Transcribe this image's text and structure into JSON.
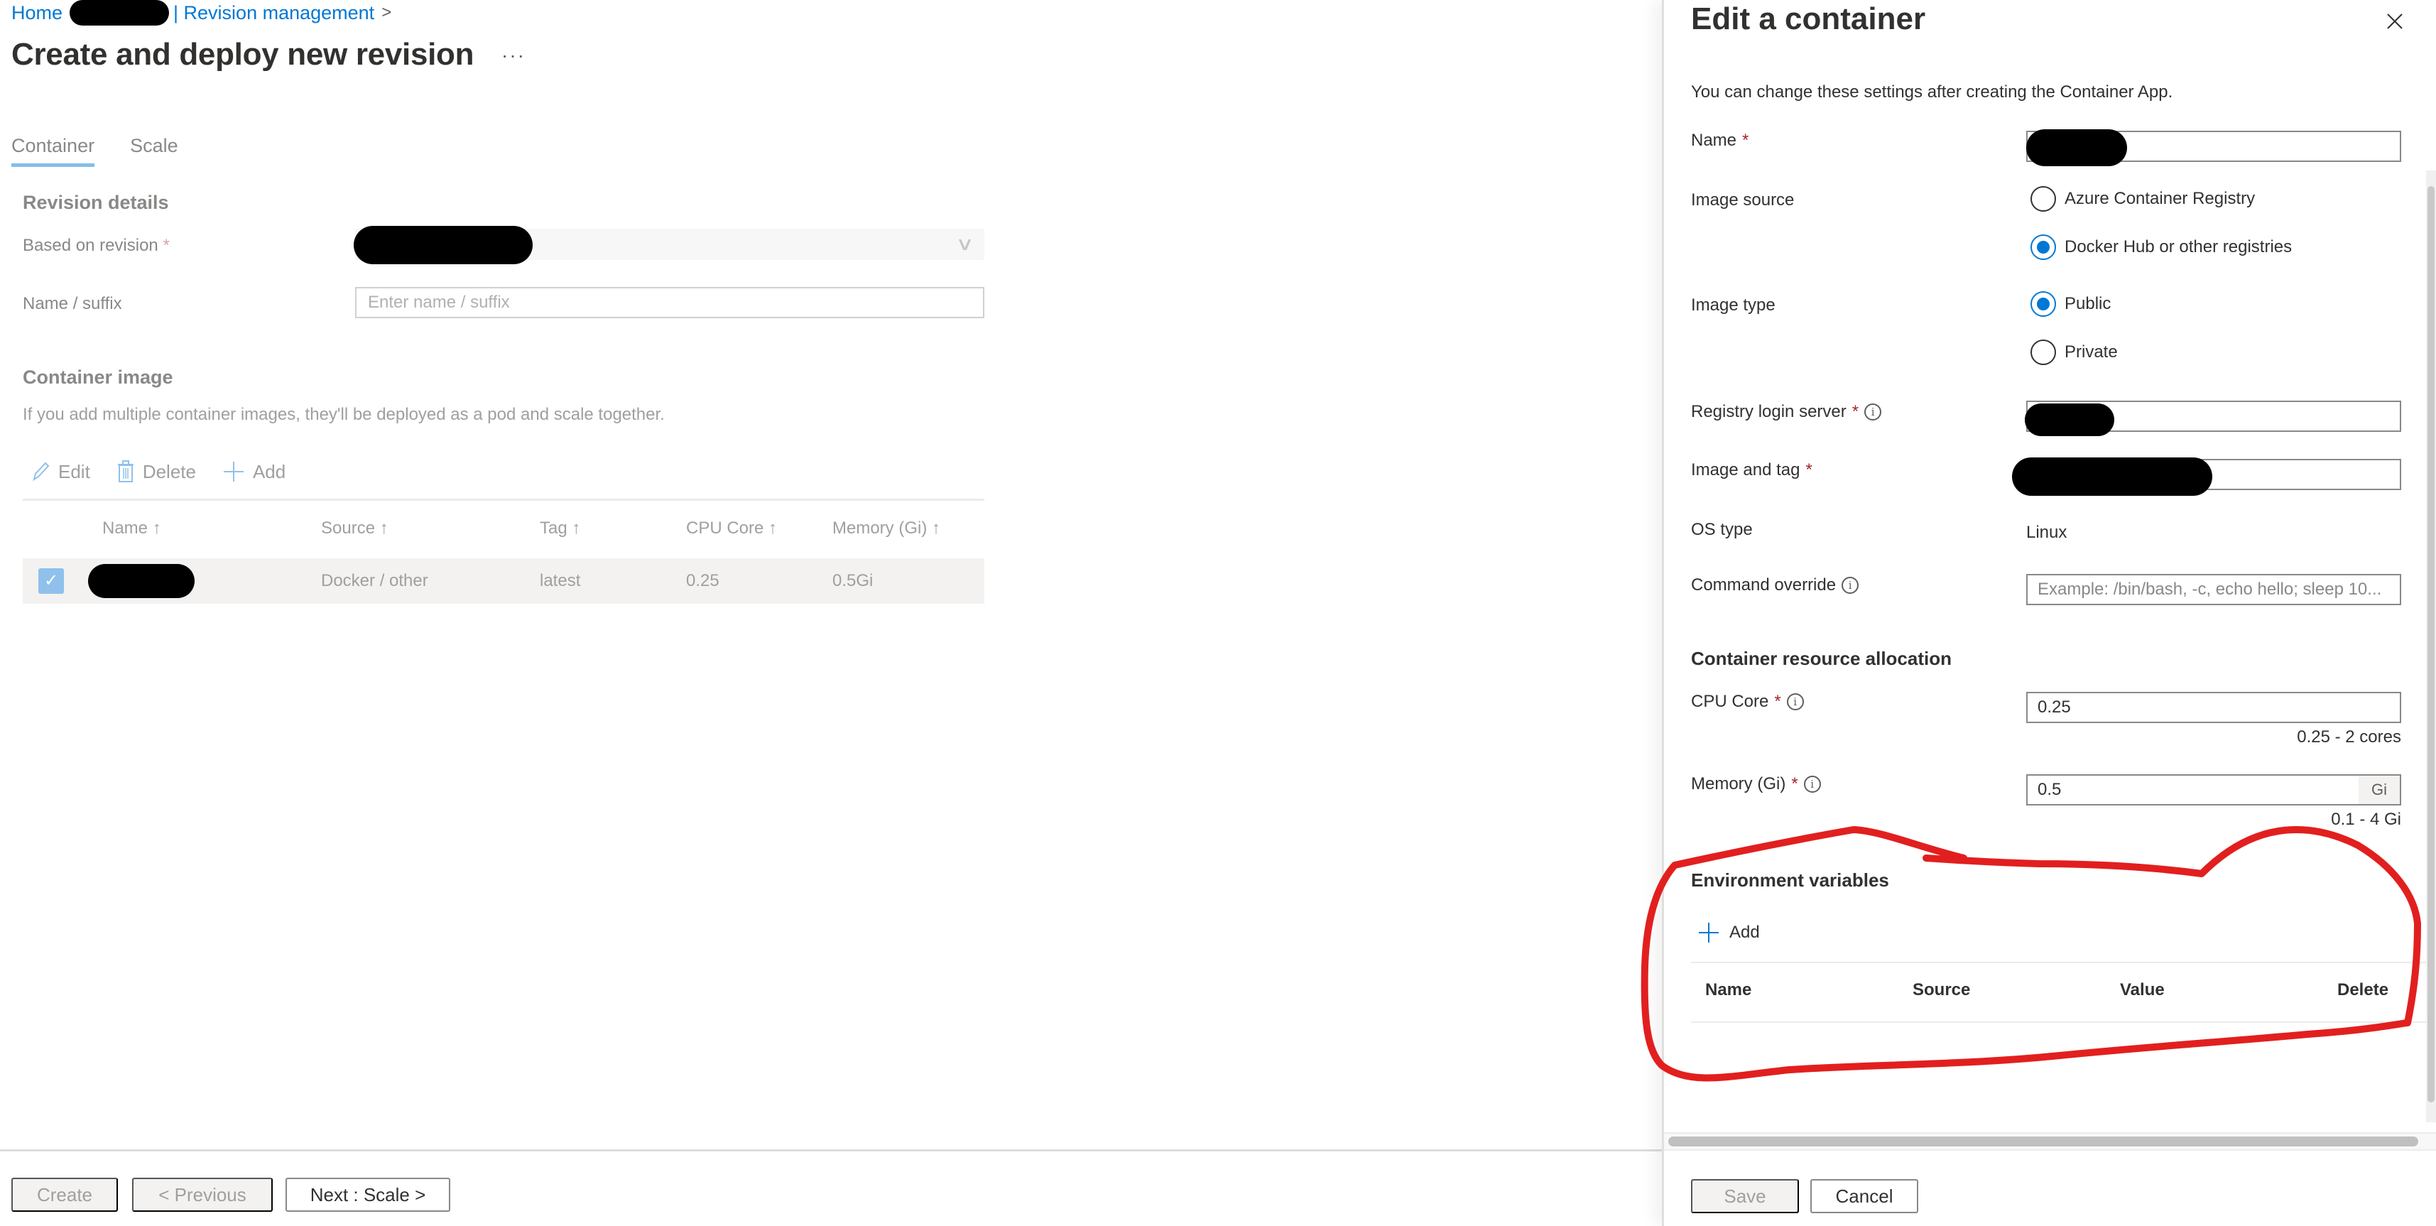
{
  "breadcrumb": {
    "items": [
      "Home",
      "| Revision management"
    ],
    "separator": ">"
  },
  "page": {
    "title": "Create and deploy new revision",
    "more_label": "···"
  },
  "tabs": [
    {
      "label": "Container",
      "active": true
    },
    {
      "label": "Scale",
      "active": false
    }
  ],
  "revision_details": {
    "heading": "Revision details",
    "based_on_label": "Based on revision",
    "required_mark": "*",
    "name_suffix_label": "Name / suffix",
    "name_suffix_placeholder": "Enter name / suffix",
    "name_suffix_value": ""
  },
  "container_image": {
    "heading": "Container image",
    "helper": "If you add multiple container images, they'll be deployed as a pod and scale together.",
    "commands": {
      "edit": "Edit",
      "delete": "Delete",
      "add": "Add"
    },
    "columns": [
      "Name ↑",
      "Source ↑",
      "Tag ↑",
      "CPU Core ↑",
      "Memory (Gi) ↑"
    ],
    "rows": [
      {
        "checked": true,
        "name": "",
        "source": "Docker / other",
        "tag": "latest",
        "cpu": "0.25",
        "memory": "0.5Gi"
      }
    ]
  },
  "footer": {
    "create": "Create",
    "previous": "< Previous",
    "next": "Next : Scale >"
  },
  "edit_pane": {
    "title": "Edit a container",
    "intro": "You can change these settings after creating the Container App.",
    "required_mark": "*",
    "name_label": "Name",
    "image_source_label": "Image source",
    "image_source_options": [
      {
        "label": "Azure Container Registry",
        "selected": false
      },
      {
        "label": "Docker Hub or other registries",
        "selected": true
      }
    ],
    "image_type_label": "Image type",
    "image_type_options": [
      {
        "label": "Public",
        "selected": true
      },
      {
        "label": "Private",
        "selected": false
      }
    ],
    "registry_label": "Registry login server",
    "image_tag_label": "Image and tag",
    "os_type_label": "OS type",
    "os_type_value": "Linux",
    "command_override_label": "Command override",
    "command_override_placeholder": "Example: /bin/bash, -c, echo hello; sleep 10...",
    "resource_heading": "Container resource allocation",
    "cpu_label": "CPU Core",
    "cpu_value": "0.25",
    "cpu_hint": "0.25 - 2 cores",
    "memory_label": "Memory (Gi)",
    "memory_value": "0.5",
    "memory_suffix": "Gi",
    "memory_hint": "0.1 - 4 Gi",
    "env_heading": "Environment variables",
    "env_add": "Add",
    "env_columns": [
      "Name",
      "Source",
      "Value",
      "Delete"
    ],
    "env_rows": [],
    "save": "Save",
    "cancel": "Cancel"
  },
  "colors": {
    "accent": "#0078d4",
    "annotation": "#e21f1f",
    "disabled_bg": "#f3f2f1"
  }
}
